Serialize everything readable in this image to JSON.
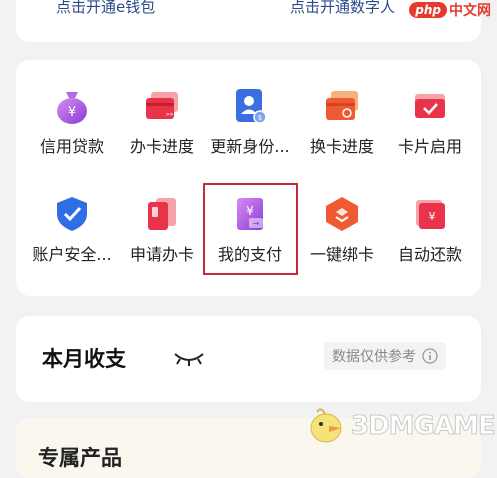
{
  "top": {
    "left_link": "点击开通e钱包",
    "right_link": "点击开通数字人"
  },
  "grid": {
    "row1": [
      {
        "label": "信用贷款",
        "icon": "money-bag-icon"
      },
      {
        "label": "办卡进度",
        "icon": "card-progress-icon"
      },
      {
        "label": "更新身份...",
        "icon": "id-card-update-icon"
      },
      {
        "label": "换卡进度",
        "icon": "card-replace-icon"
      },
      {
        "label": "卡片启用",
        "icon": "card-activate-icon"
      }
    ],
    "row2": [
      {
        "label": "账户安全...",
        "icon": "shield-check-icon"
      },
      {
        "label": "申请办卡",
        "icon": "apply-card-icon"
      },
      {
        "label": "我的支付",
        "icon": "my-payment-icon"
      },
      {
        "label": "一键绑卡",
        "icon": "bind-card-icon"
      },
      {
        "label": "自动还款",
        "icon": "auto-repay-icon"
      }
    ]
  },
  "summary": {
    "title": "本月收支",
    "note": "数据仅供参考"
  },
  "bottom": {
    "title": "专属产品"
  },
  "watermarks": {
    "php_pill": "php",
    "php_cn": "中文网",
    "site": "3DMGAME"
  },
  "colors": {
    "accent_red": "#e8334a",
    "highlight_border": "#c62a3a",
    "link_blue": "#2c4a8a"
  }
}
